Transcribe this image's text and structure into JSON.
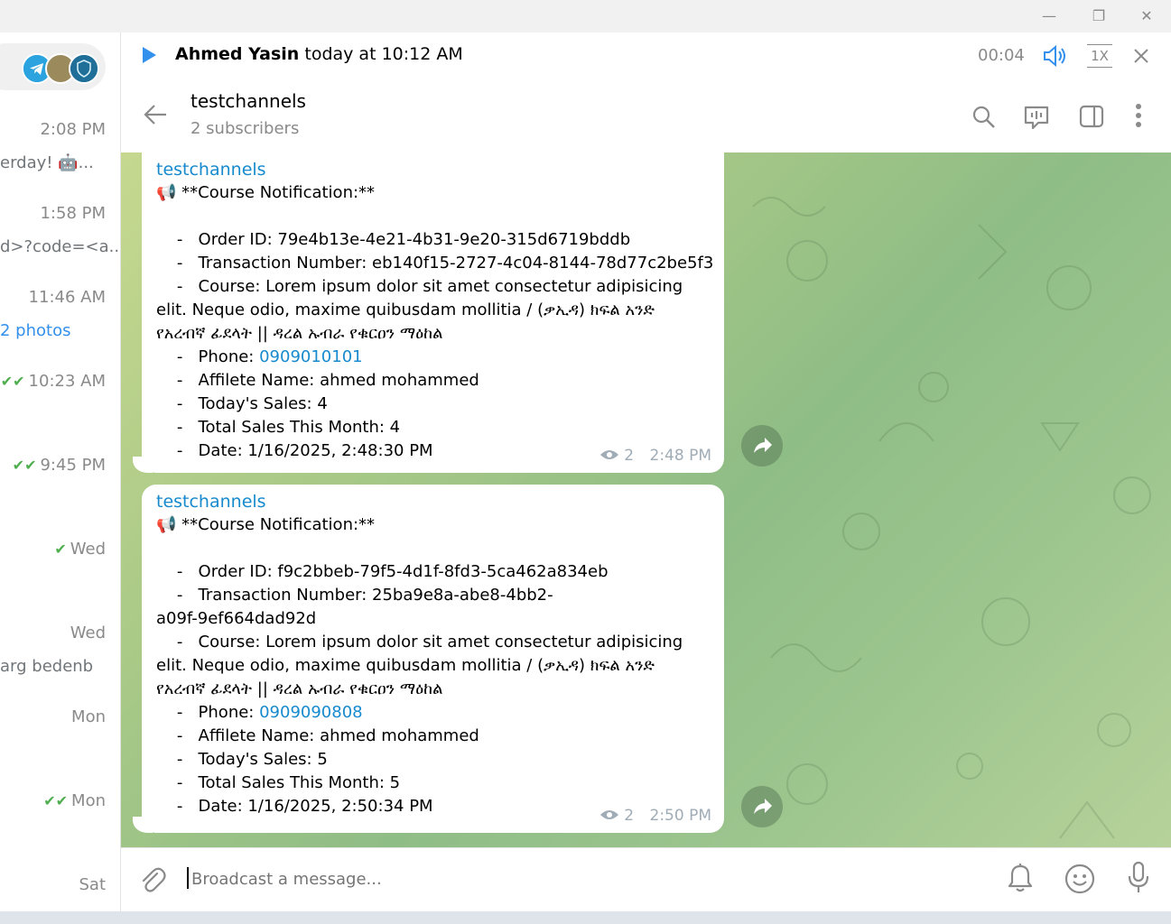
{
  "window": {
    "minimize": "—",
    "restore": "❐",
    "close": "✕"
  },
  "chat_list": [
    {
      "time": "2:08 PM",
      "subtitle": "erday! 🤖..."
    },
    {
      "time": "1:58 PM",
      "subtitle": "d>?code=<a..."
    },
    {
      "time": "11:46 AM",
      "subtitle": "2 photos"
    },
    {
      "time": "10:23 AM",
      "subtitle": ""
    },
    {
      "time": "9:45 PM",
      "subtitle": ""
    },
    {
      "time": "Wed",
      "subtitle": ""
    },
    {
      "time": "Wed",
      "subtitle": "arg bedenb"
    },
    {
      "time": "Mon",
      "subtitle": ""
    },
    {
      "time": "Mon",
      "subtitle": ""
    },
    {
      "time": "Sat",
      "subtitle": ""
    }
  ],
  "player": {
    "name": "Ahmed Yasin",
    "when": "today at 10:12 AM",
    "elapsed": "00:04",
    "speed": "1X"
  },
  "header": {
    "title": "testchannels",
    "subtitle": "2 subscribers"
  },
  "messages": [
    {
      "sender": "testchannels",
      "heading": "📢 **Course Notification:**",
      "order": "    -   Order ID: 79e4b13e-4e21-4b31-9e20-315d6719bddb",
      "txn1": "    -   Transaction Number: eb140f15-2727-4c04-8144-78d77c2be5f3",
      "txn2": "",
      "course1": "    -   Course: Lorem ipsum dolor sit amet consectetur adipisicing",
      "course2": "elit. Neque odio, maxime quibusdam mollitia / (ቃኢዳ) ክፍል አንድ",
      "course3": "የአረብኛ ፊደላት || ዳረል ኡብራ የቁርዐን ማዕከል",
      "phone_label": "    -   Phone: ",
      "phone": "0909010101",
      "affiliate": "    -   Affilete Name: ahmed mohammed",
      "today": "    -   Today's Sales: 4",
      "month": "    -   Total Sales This Month: 4",
      "date": "    -   Date: 1/16/2025, 2:48:30 PM",
      "views": "2",
      "time": "2:48 PM"
    },
    {
      "sender": "testchannels",
      "heading": "📢 **Course Notification:**",
      "order": "    -   Order ID: f9c2bbeb-79f5-4d1f-8fd3-5ca462a834eb",
      "txn1": "    -   Transaction Number: 25ba9e8a-abe8-4bb2-",
      "txn2": "a09f-9ef664dad92d",
      "course1": "    -   Course: Lorem ipsum dolor sit amet consectetur adipisicing",
      "course2": "elit. Neque odio, maxime quibusdam mollitia / (ቃኢዳ) ክፍል አንድ",
      "course3": "የአረብኛ ፊደላት || ዳረል ኡብራ የቁርዐን ማዕከል",
      "phone_label": "    -   Phone: ",
      "phone": "0909090808",
      "affiliate": "    -   Affilete Name: ahmed mohammed",
      "today": "    -   Today's Sales: 5",
      "month": "    -   Total Sales This Month: 5",
      "date": "    -   Date: 1/16/2025, 2:50:34 PM",
      "views": "2",
      "time": "2:50 PM"
    }
  ],
  "composer": {
    "placeholder": "Broadcast a message..."
  },
  "colors": {
    "accent": "#3390ec",
    "link": "#168acd",
    "read_check": "#4fae4e"
  }
}
